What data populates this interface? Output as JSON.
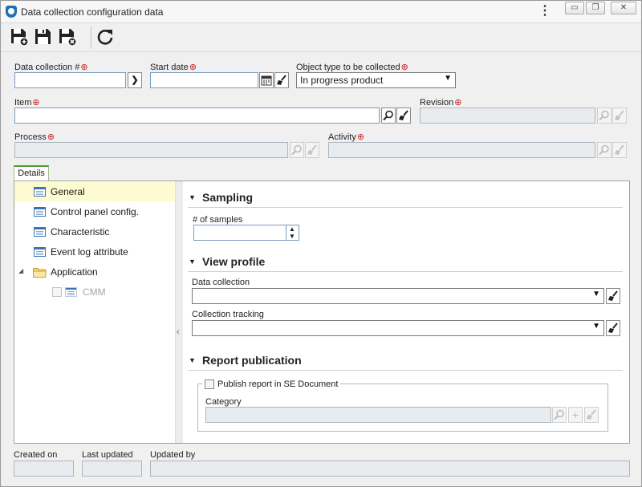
{
  "window": {
    "title": "Data collection configuration data",
    "menu_glyph": "⋮",
    "minimize_glyph": "▭",
    "restore_glyph": "❐",
    "close_glyph": "✕"
  },
  "toolbar": {
    "icons": [
      "save-new-icon",
      "save-icon",
      "save-close-icon",
      "refresh-icon"
    ]
  },
  "form": {
    "data_collection_label": "Data collection #",
    "data_collection_value": "",
    "start_date_label": "Start date",
    "start_date_value": "",
    "object_type_label": "Object type to be collected",
    "object_type_value": "In progress product",
    "item_label": "Item",
    "item_value": "",
    "revision_label": "Revision",
    "revision_value": "",
    "process_label": "Process",
    "process_value": "",
    "activity_label": "Activity",
    "activity_value": "",
    "required_glyph": "⊕"
  },
  "details": {
    "tab_label": "Details",
    "tree": [
      {
        "label": "General",
        "selected": true
      },
      {
        "label": "Control panel config."
      },
      {
        "label": "Characteristic"
      },
      {
        "label": "Event log attribute"
      },
      {
        "label": "Application"
      },
      {
        "label": "CMM"
      }
    ],
    "expand_glyph": "◢",
    "collapse_panel_glyph": "‹",
    "section_glyph": "▼",
    "sampling_title": "Sampling",
    "samples_label": "# of samples",
    "samples_value": "",
    "view_profile_title": "View profile",
    "data_collection_label": "Data collection",
    "data_collection_value": "",
    "collection_tracking_label": "Collection tracking",
    "collection_tracking_value": "",
    "report_publication_title": "Report publication",
    "publish_label": "Publish report in SE Document",
    "category_label": "Category",
    "category_value": ""
  },
  "footer": {
    "created_on_label": "Created on",
    "created_on_value": "",
    "last_updated_label": "Last updated",
    "last_updated_value": "",
    "updated_by_label": "Updated by",
    "updated_by_value": ""
  }
}
